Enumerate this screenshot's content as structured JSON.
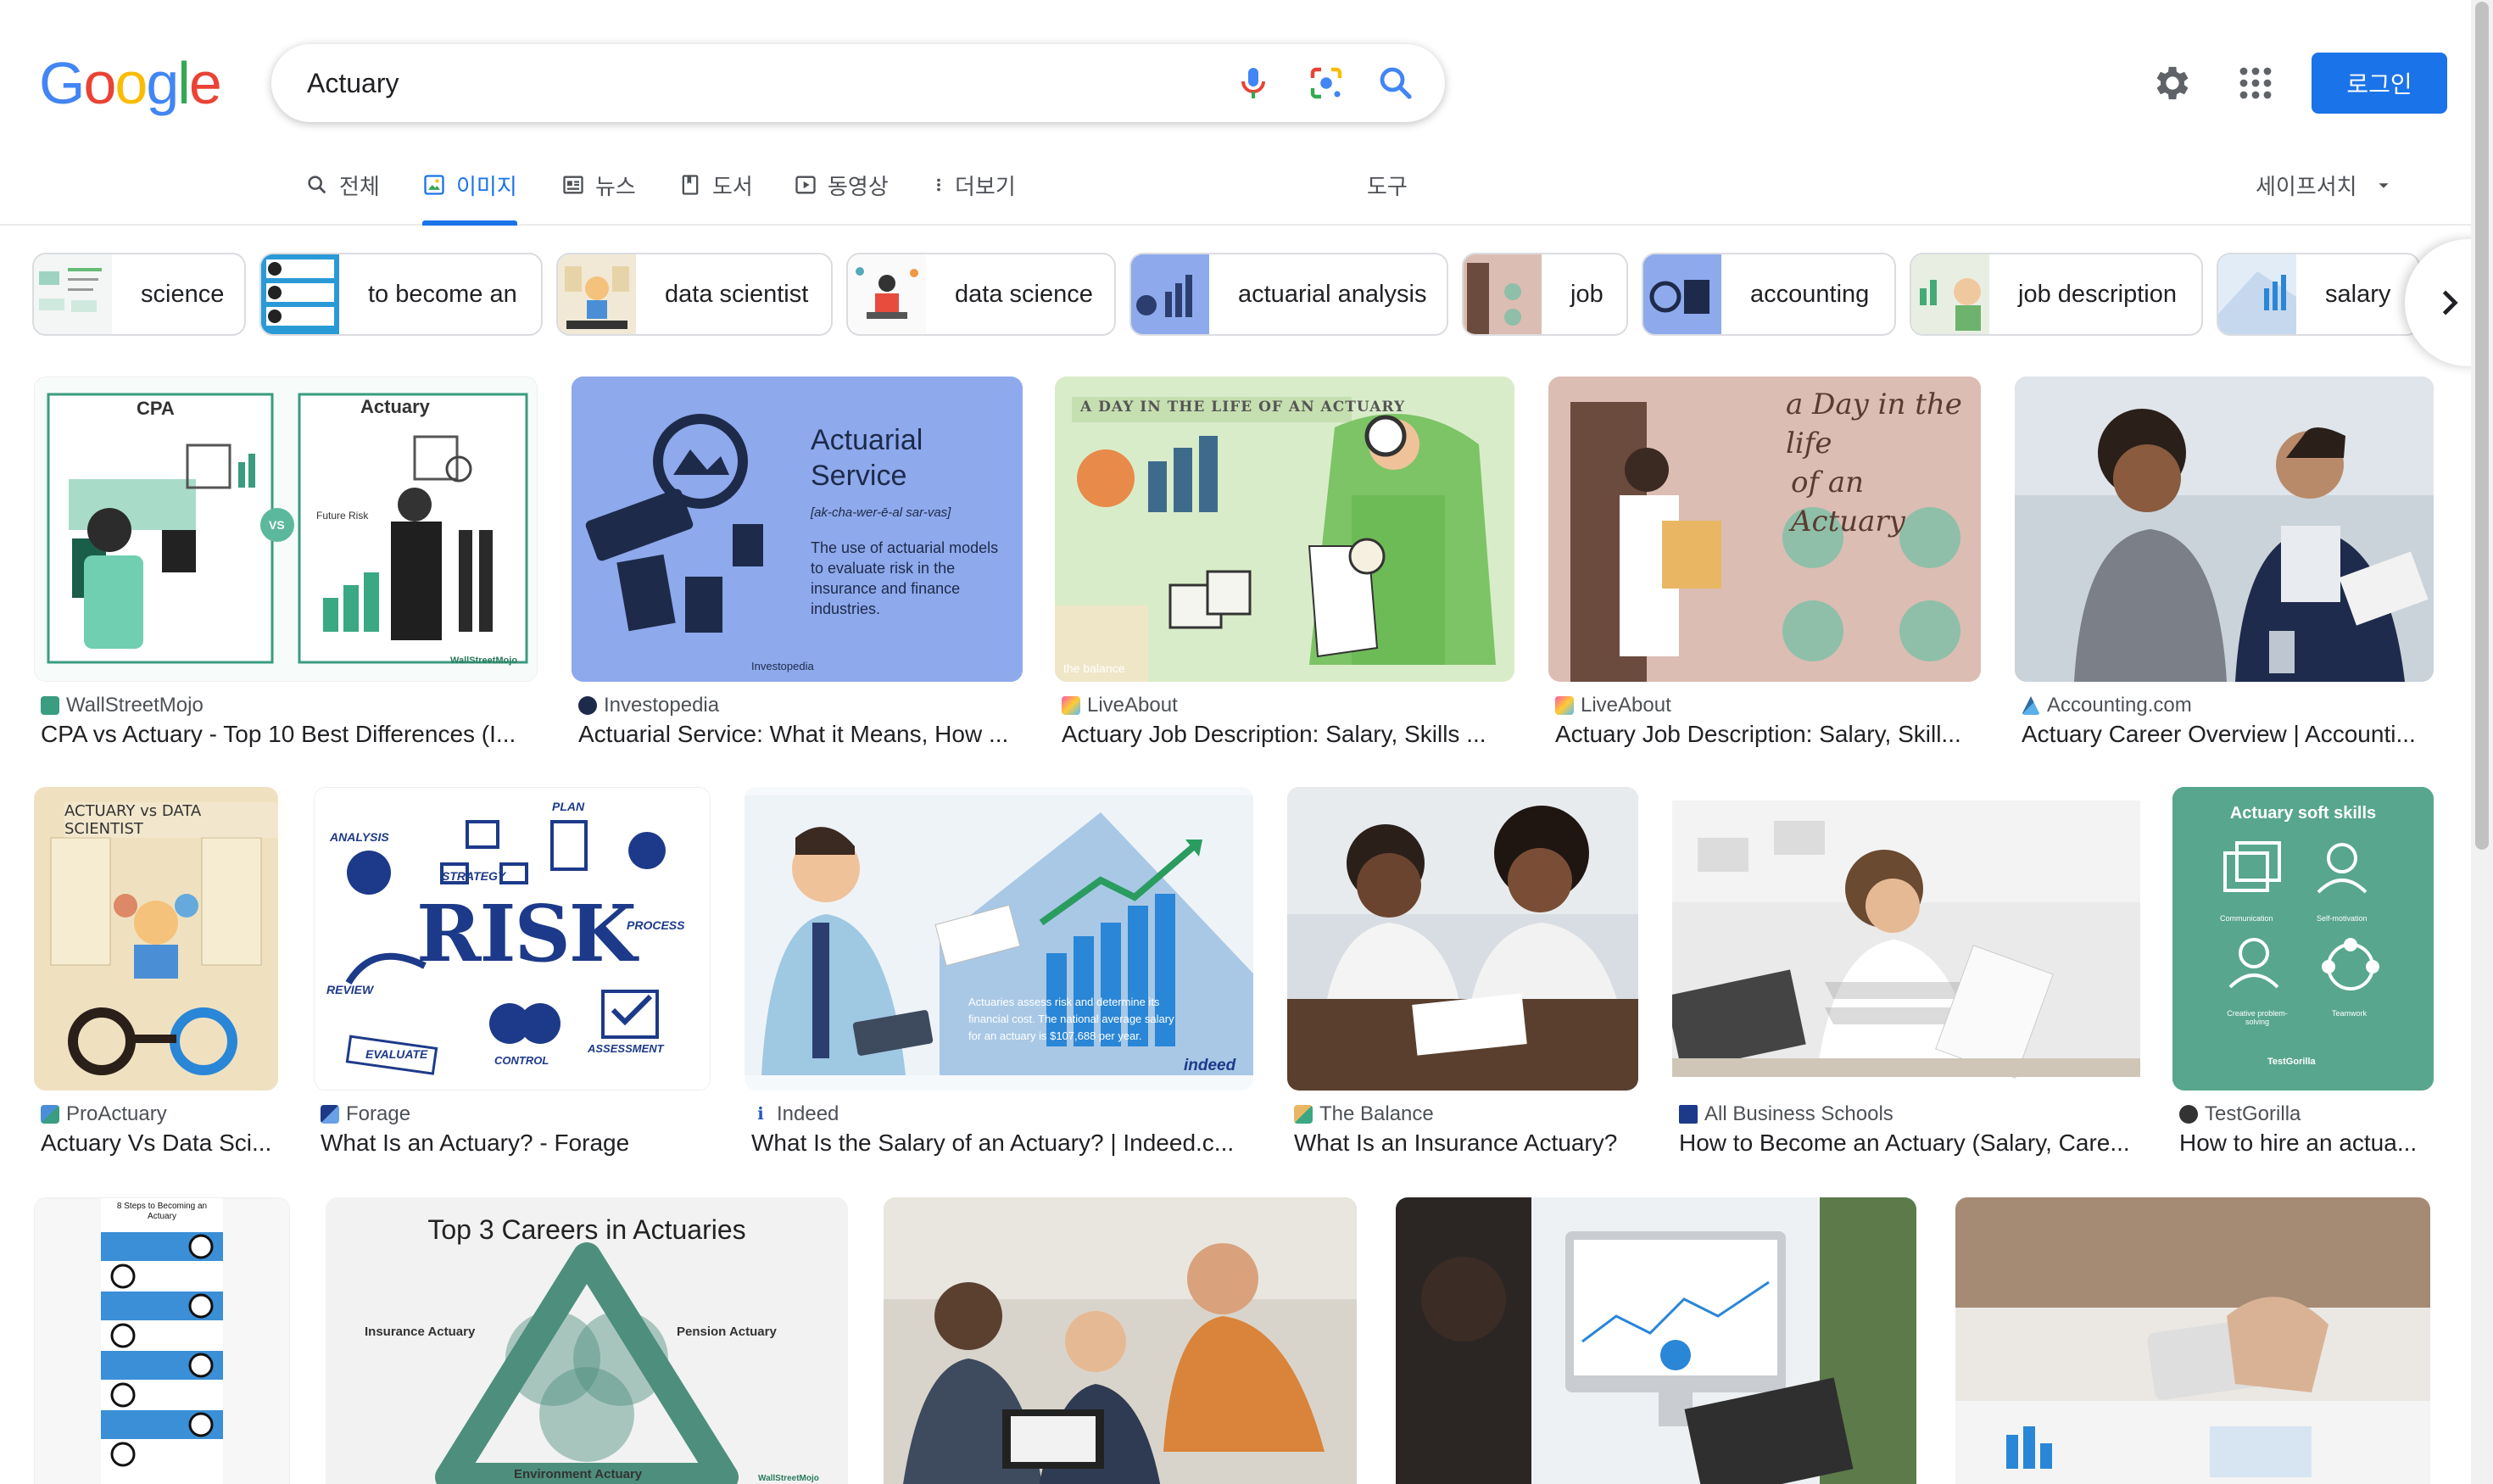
{
  "logo": {
    "letters": [
      "G",
      "o",
      "o",
      "g",
      "l",
      "e"
    ]
  },
  "search": {
    "value": "Actuary",
    "placeholder": ""
  },
  "header": {
    "login_label": "로그인"
  },
  "tabs": [
    {
      "label": "전체",
      "icon": "search-icon"
    },
    {
      "label": "이미지",
      "icon": "image-icon",
      "active": true
    },
    {
      "label": "뉴스",
      "icon": "news-icon"
    },
    {
      "label": "도서",
      "icon": "book-icon"
    },
    {
      "label": "동영상",
      "icon": "video-icon"
    },
    {
      "label": "더보기",
      "icon": "more-vert-icon"
    }
  ],
  "tools_label": "도구",
  "safesearch_label": "세이프서치",
  "chips": [
    {
      "label": "science"
    },
    {
      "label": "to become an"
    },
    {
      "label": "data scientist"
    },
    {
      "label": "data science"
    },
    {
      "label": "actuarial analysis"
    },
    {
      "label": "job"
    },
    {
      "label": "accounting"
    },
    {
      "label": "job description"
    },
    {
      "label": "salary"
    }
  ],
  "results": [
    {
      "source": "WallStreetMojo",
      "title": "CPA vs Actuary - Top 10 Best Differences (I...",
      "thumb": {
        "heading_left": "CPA",
        "heading_right": "Actuary",
        "vs": "VS",
        "caption": "Future Risk",
        "brand": "WallStreetMojo"
      }
    },
    {
      "source": "Investopedia",
      "title": "Actuarial Service: What it Means, How ...",
      "thumb": {
        "heading_1": "Actuarial",
        "heading_2": "Service",
        "phonetic": "[ak-cha-wer-ē-al sar-vas]",
        "body": "The use of actuarial models to evaluate risk in the insurance and finance industries.",
        "brand": "Investopedia"
      }
    },
    {
      "source": "LiveAbout",
      "title": "Actuary Job Description: Salary, Skills ...",
      "thumb": {
        "heading": "A DAY IN THE LIFE OF AN ACTUARY",
        "brand": "the balance"
      }
    },
    {
      "source": "LiveAbout",
      "title": "Actuary Job Description: Salary, Skill...",
      "thumb": {
        "heading_1": "a Day in the life",
        "heading_2": "of an Actuary"
      }
    },
    {
      "source": "Accounting.com",
      "title": "Actuary Career Overview | Accounti..."
    },
    {
      "source": "ProActuary",
      "title": "Actuary Vs Data Sci...",
      "thumb": {
        "heading": "ACTUARY vs DATA SCIENTIST"
      }
    },
    {
      "source": "Forage",
      "title": "What Is an Actuary? - Forage",
      "thumb": {
        "word": "RISK",
        "labels": [
          "ANALYSIS",
          "STRATEGY",
          "PLAN",
          "PROCESS",
          "REVIEW",
          "EVALUATE",
          "CONTROL",
          "ASSESSMENT"
        ]
      }
    },
    {
      "source": "Indeed",
      "title": "What Is the Salary of an Actuary? | Indeed.c...",
      "thumb": {
        "body": "Actuaries assess risk and determine its financial cost. The national average salary for an actuary is $107,688 per year.",
        "brand": "indeed"
      }
    },
    {
      "source": "The Balance",
      "title": "What Is an Insurance Actuary?"
    },
    {
      "source": "All Business Schools",
      "title": "How to Become an Actuary (Salary, Care..."
    },
    {
      "source": "TestGorilla",
      "title": "How to hire an actua...",
      "thumb": {
        "heading": "Actuary soft skills",
        "labels": [
          "Communication",
          "Self-motivation",
          "Creative problem-solving",
          "Teamwork"
        ],
        "brand": "TestGorilla"
      }
    },
    {
      "thumb": {
        "heading": "8 Steps to Becoming an Actuary"
      }
    },
    {
      "thumb": {
        "heading": "Top 3 Careers in Actuaries",
        "labels": [
          "Insurance Actuary",
          "Pension Actuary",
          "Environment Actuary"
        ],
        "brand": "WallStreetMojo"
      }
    },
    {},
    {},
    {}
  ],
  "colors": {
    "accent": "#1a73e8",
    "text": "#202124",
    "muted": "#4d5156",
    "border": "#dadce0"
  }
}
